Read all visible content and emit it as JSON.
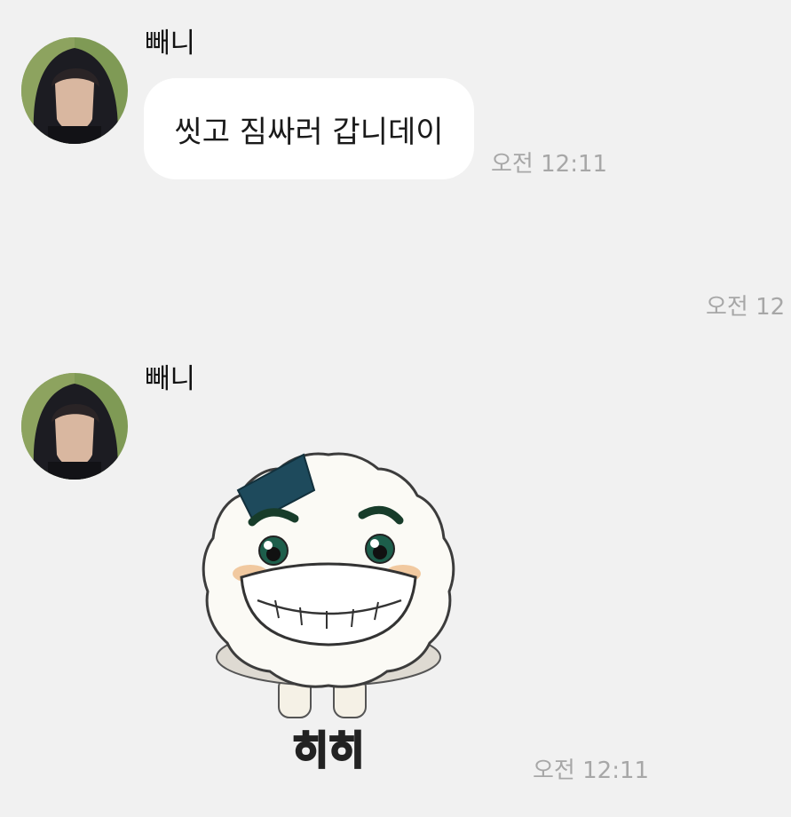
{
  "messages": [
    {
      "sender": "빼니",
      "type": "text",
      "text": "씻고 짐싸러 갑니데이",
      "time": "오전 12:11"
    },
    {
      "type": "time-only",
      "time": "오전 12"
    },
    {
      "sender": "빼니",
      "type": "sticker",
      "sticker_name": "smiling-rice-ball-sticker",
      "sticker_text": "히히",
      "time": "오전 12:11"
    }
  ],
  "colors": {
    "background": "#f1f1f1",
    "bubble": "#ffffff",
    "timestamp": "#a7a7a7"
  }
}
